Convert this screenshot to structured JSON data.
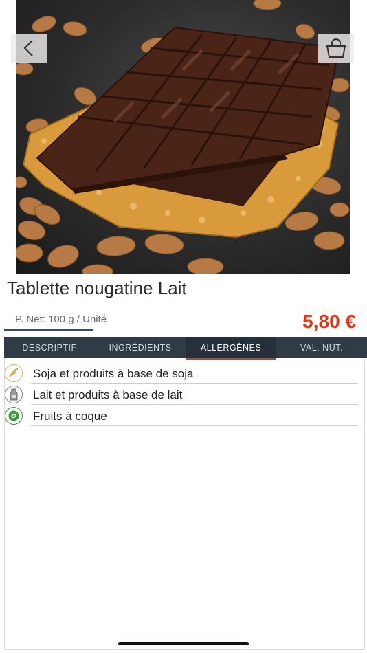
{
  "product": {
    "title": "Tablette nougatine Lait",
    "weight": "P. Net: 100 g / Unité",
    "price": "5,80 €"
  },
  "tabs": [
    {
      "label": "DESCRIPTIF",
      "active": false
    },
    {
      "label": "INGRÉDIENTS",
      "active": false
    },
    {
      "label": "ALLERGÈNES",
      "active": true
    },
    {
      "label": "VAL. NUT.",
      "active": false
    }
  ],
  "allergens": [
    {
      "label": "Soja et produits à base de soja",
      "icon": "soy-icon",
      "color": "#d7b46a"
    },
    {
      "label": "Lait et produits à base de lait",
      "icon": "milk-icon",
      "color": "#8a8a8a"
    },
    {
      "label": "Fruits à coque",
      "icon": "nut-icon",
      "color": "#3a9a3a"
    }
  ],
  "colors": {
    "price": "#d83a1e",
    "tab_bar": "#2f3b45",
    "tab_active_underline": "#d83a1e"
  },
  "icons": {
    "back": "chevron-left-icon",
    "cart": "shopping-bag-icon"
  }
}
